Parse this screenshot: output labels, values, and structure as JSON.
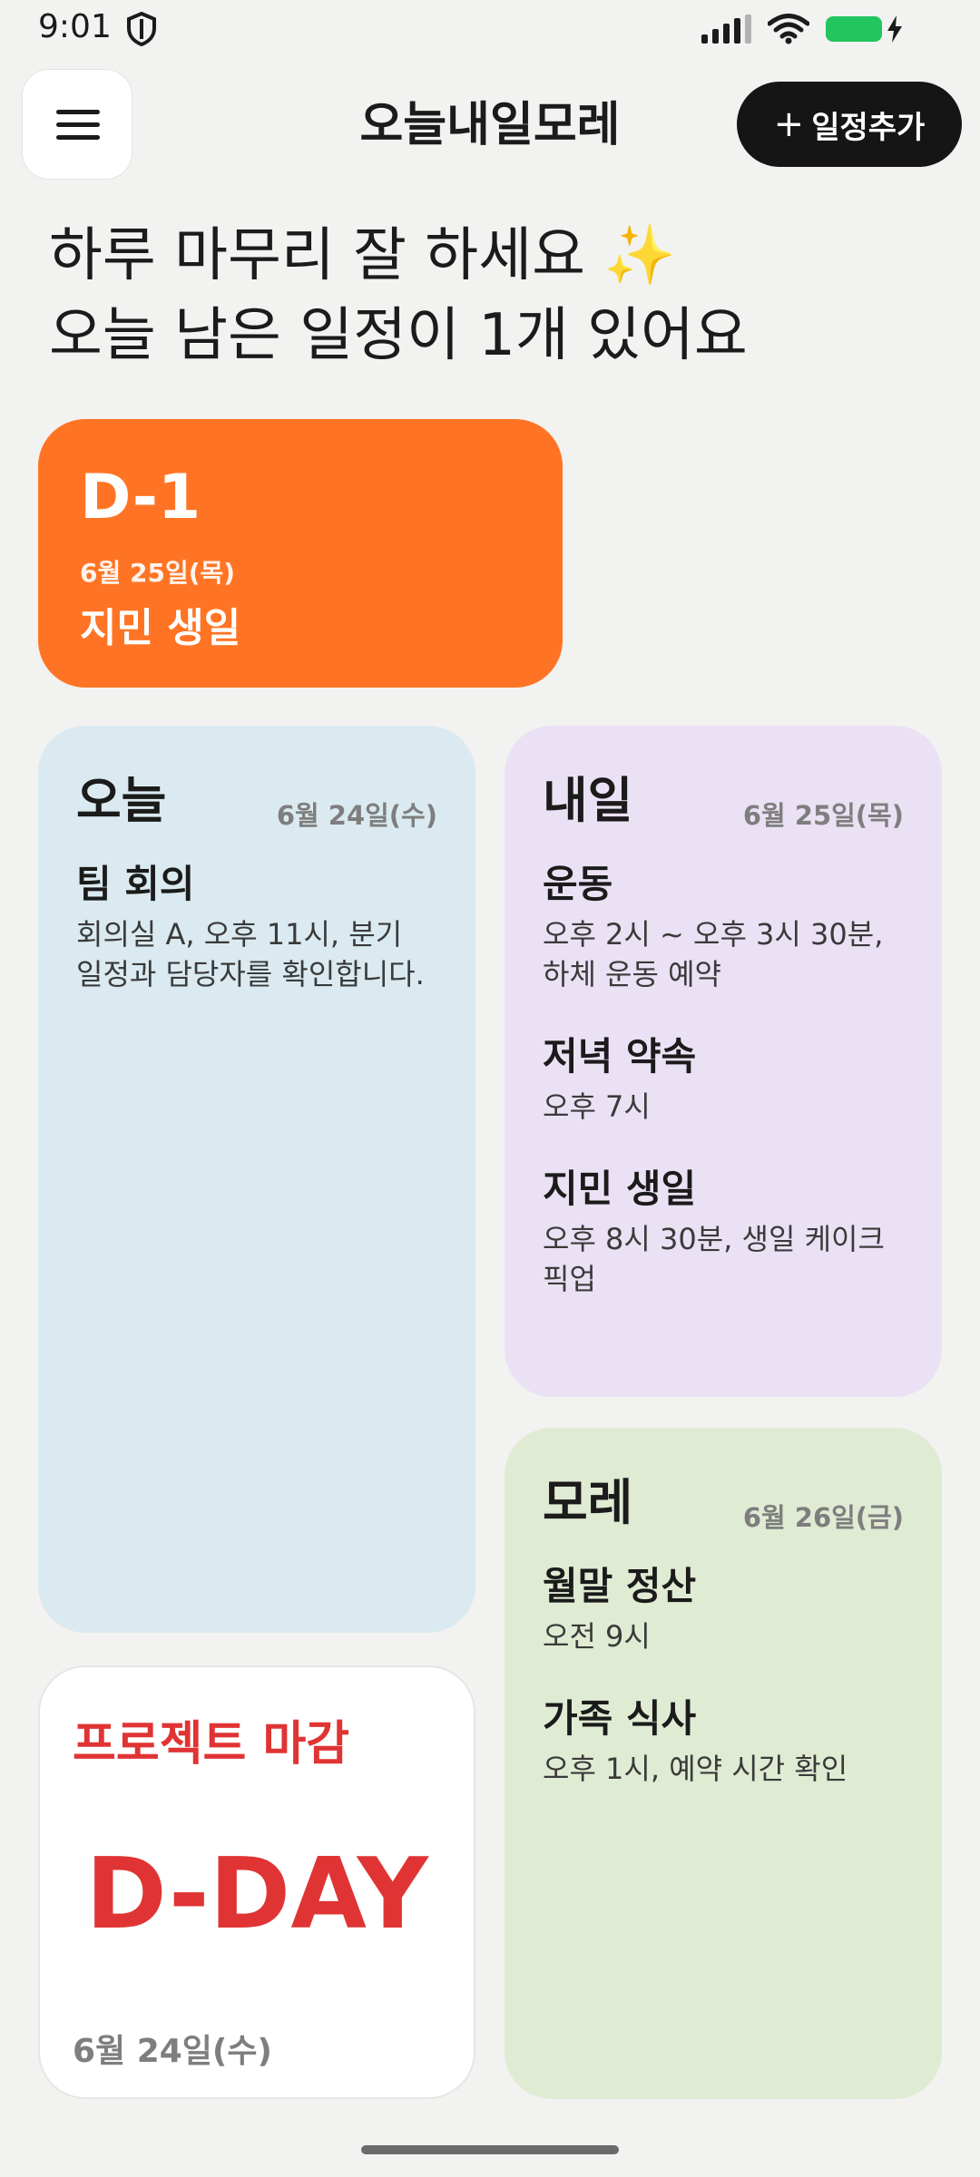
{
  "status_bar": {
    "time": "9:01"
  },
  "header": {
    "title": "오늘내일모레",
    "add_button_label": "일정추가",
    "add_button_icon": "plus-icon",
    "menu_icon": "hamburger-icon"
  },
  "greeting": {
    "line1": "하루 마무리 잘 하세요 ✨",
    "line2": "오늘 남은 일정이 1개 있어요"
  },
  "dday_card": {
    "countdown": "D-1",
    "date": "6월 25일(목)",
    "title": "지민 생일",
    "color": "#FF7424"
  },
  "today": {
    "heading": "오늘",
    "date": "6월 24일(수)",
    "events": [
      {
        "title": "팀 회의",
        "desc": "회의실 A, 오후 11시, 분기 일정과 담당자를 확인합니다."
      }
    ]
  },
  "tomorrow": {
    "heading": "내일",
    "date": "6월 25일(목)",
    "events": [
      {
        "title": "운동",
        "desc": "오후 2시 ~ 오후 3시 30분, 하체 운동 예약"
      },
      {
        "title": "저녁 약속",
        "desc": "오후 7시"
      },
      {
        "title": "지민 생일",
        "desc": "오후 8시 30분, 생일 케이크 픽업"
      }
    ]
  },
  "day_after": {
    "heading": "모레",
    "date": "6월 26일(금)",
    "events": [
      {
        "title": "월말 정산",
        "desc": "오전 9시"
      },
      {
        "title": "가족 식사",
        "desc": "오후 1시, 예약 시간 확인"
      }
    ]
  },
  "project_card": {
    "title": "프로젝트 마감",
    "countdown": "D-DAY",
    "date": "6월 24일(수)",
    "accent": "#E03434"
  }
}
